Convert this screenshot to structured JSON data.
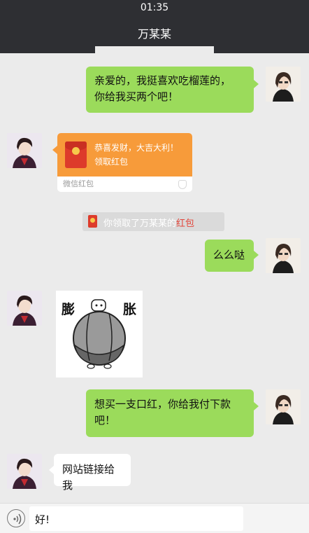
{
  "status_bar": {
    "time": "01:35"
  },
  "header": {
    "title": "万某某"
  },
  "messages": {
    "m1": {
      "line1": "亲爱的，我挺喜欢吃榴莲的，",
      "line2": "你给我买两个吧！"
    },
    "red_packet": {
      "line1": "恭喜发财，大吉大利！",
      "line2": "领取红包",
      "footer": "微信红包"
    },
    "system_note": {
      "text": "你领取了万某某的",
      "highlight": "红包"
    },
    "m3": {
      "text": "么么哒"
    },
    "sticker": {
      "left_char": "膨",
      "right_char": "胀"
    },
    "m4": {
      "line1": "想买一支口红，你给我付下款",
      "line2": "吧！"
    },
    "m5": {
      "text": "网站链接给我"
    }
  },
  "input": {
    "value": "好!"
  },
  "colors": {
    "header_bg": "#2e2f33",
    "chat_bg": "#ebebeb",
    "self_bubble": "#9bdb5b",
    "red_packet": "#f79b3a",
    "highlight_red": "#e2453a"
  }
}
